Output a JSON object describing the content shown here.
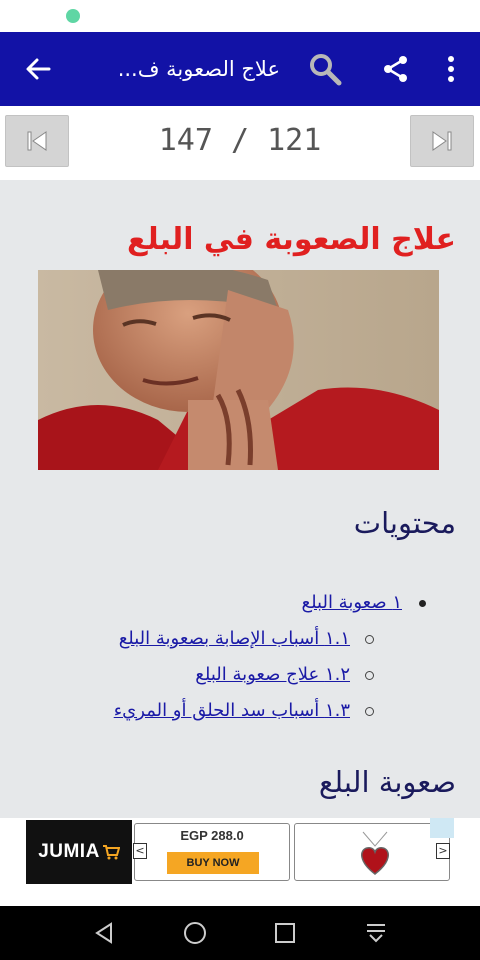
{
  "app_bar": {
    "title": "علاج الصعوبة ف...",
    "icons": [
      "back-arrow-icon",
      "search-icon",
      "share-icon",
      "more-vert-icon"
    ]
  },
  "pager": {
    "counter": "147 / 121",
    "icons": [
      "skip-first-icon",
      "skip-last-icon"
    ]
  },
  "article": {
    "title": "علاج الصعوبة في البلع",
    "contents_heading": "محتويات",
    "toc": [
      {
        "label": "١ صعوبة البلع",
        "level": 1
      },
      {
        "label": "١.١ أسباب الإصابة بصعوبة البلع",
        "level": 2
      },
      {
        "label": "١.٢ علاج صعوبة البلع",
        "level": 2
      },
      {
        "label": "١.٣ أسباب سد الحلق أو المريء",
        "level": 2
      }
    ],
    "section_heading": "صعوبة البلع"
  },
  "ad": {
    "brand": "JUMIA",
    "price": "EGP 288.0",
    "cta": "BUY NOW",
    "prev": "<",
    "next": ">"
  },
  "colors": {
    "app_bar": "#1212a6",
    "title_red": "#e02020",
    "link_blue": "#1a1aa6",
    "heading_navy": "#1a1a5c"
  }
}
